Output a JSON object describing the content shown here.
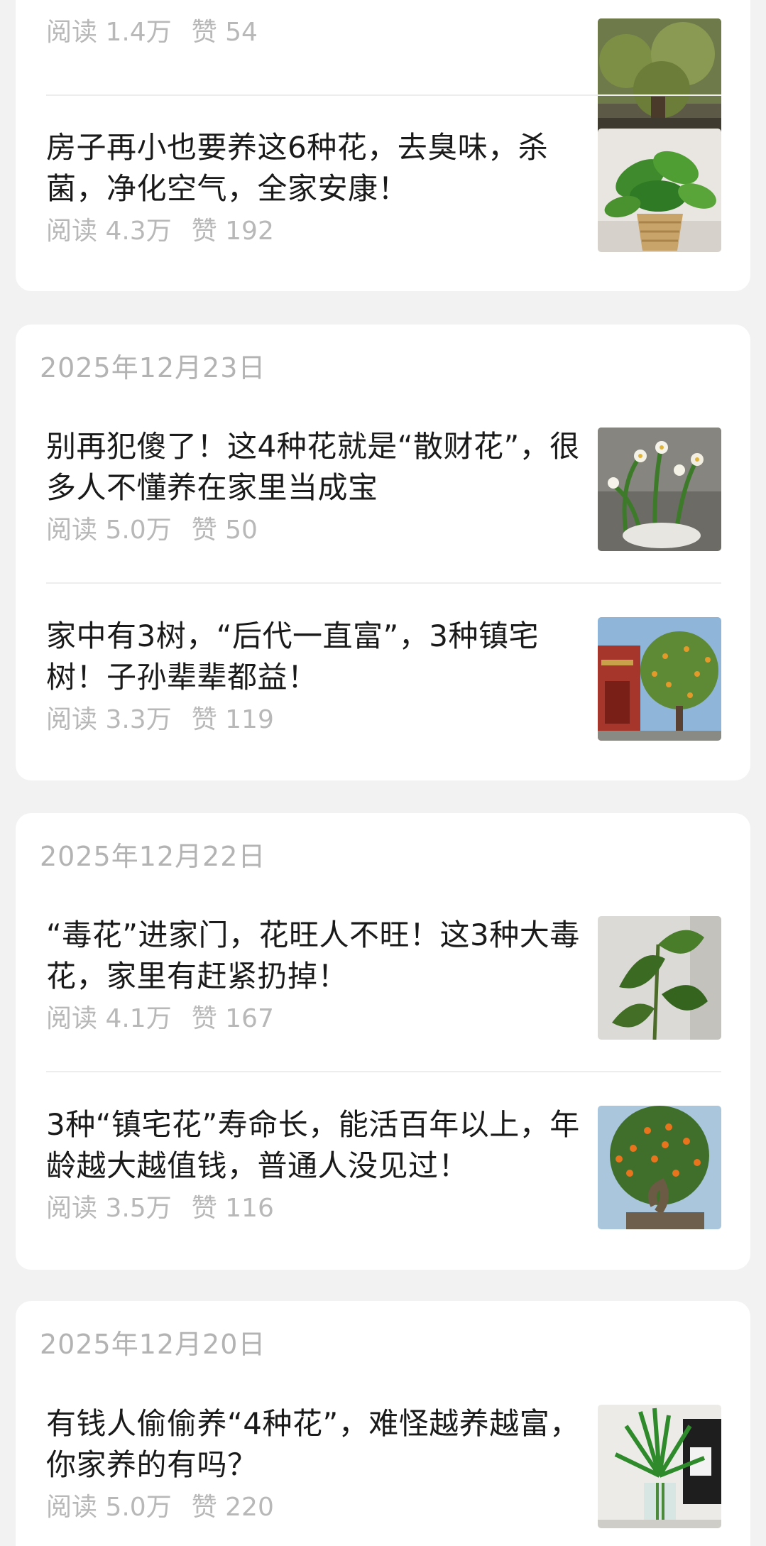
{
  "groups": [
    {
      "date": "",
      "articles": [
        {
          "title": "",
          "reads": "阅读 1.4万",
          "likes": "赞 54",
          "thumb": "tree-bonsai-photo"
        },
        {
          "title": "房子再小也要养这6种花，去臭味，杀菌，净化空气，全家安康！",
          "reads": "阅读 4.3万",
          "likes": "赞 192",
          "thumb": "pothos-basket-photo"
        }
      ]
    },
    {
      "date": "2025年12月23日",
      "articles": [
        {
          "title": "别再犯傻了！这4种花就是“散财花”，很多人不懂养在家里当成宝",
          "reads": "阅读 5.0万",
          "likes": "赞 50",
          "thumb": "narcissus-pot-photo"
        },
        {
          "title": "家中有3树，“后代一直富”，3种镇宅树！子孙辈辈都益！",
          "reads": "阅读 3.3万",
          "likes": "赞 119",
          "thumb": "kumquat-tree-photo"
        }
      ]
    },
    {
      "date": "2025年12月22日",
      "articles": [
        {
          "title": "“毒花”进家门，花旺人不旺！这3种大毒花，家里有赶紧扔掉！",
          "reads": "阅读 4.1万",
          "likes": "赞 167",
          "thumb": "alocasia-plant-photo"
        },
        {
          "title": "3种“镇宅花”寿命长，能活百年以上，年龄越大越值钱，普通人没见过！",
          "reads": "阅读 3.5万",
          "likes": "赞 116",
          "thumb": "orange-bonsai-photo"
        }
      ]
    },
    {
      "date": "2025年12月20日",
      "articles": [
        {
          "title": "有钱人偷偷养“4种花”，难怪越养越富，你家养的有吗？",
          "reads": "阅读 5.0万",
          "likes": "赞 220",
          "thumb": "lucky-bamboo-photo"
        }
      ]
    }
  ]
}
